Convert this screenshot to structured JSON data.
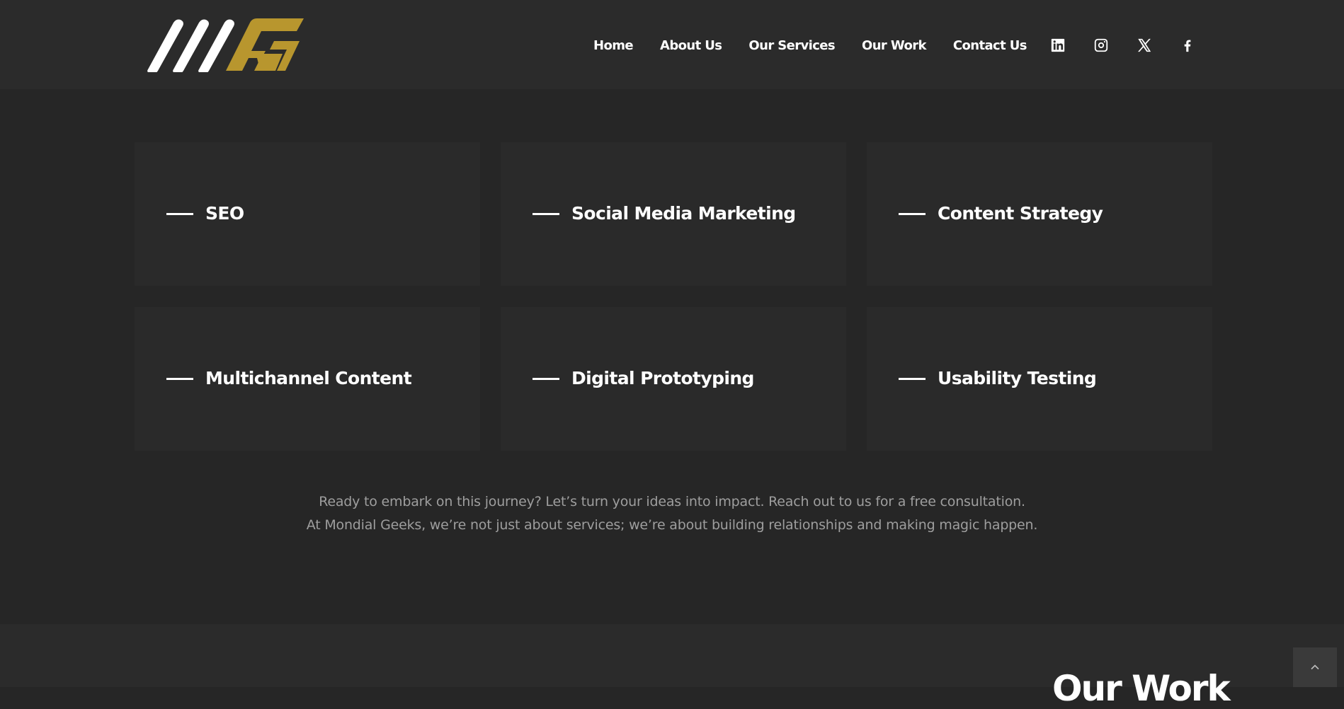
{
  "colors": {
    "page_background": "#262626",
    "header_background": "#2b2b2b",
    "card_background": "#2a2a2a",
    "brand_gold": "#b8962e",
    "text_white": "#ffffff",
    "text_muted": "#9e9e9e"
  },
  "header": {
    "logo": {
      "name": "mondial-geeks-logo"
    },
    "nav": [
      {
        "label": "Home"
      },
      {
        "label": "About Us"
      },
      {
        "label": "Our Services"
      },
      {
        "label": "Our Work"
      },
      {
        "label": "Contact Us"
      }
    ],
    "social": [
      {
        "icon": "linkedin-icon"
      },
      {
        "icon": "instagram-icon"
      },
      {
        "icon": "x-icon"
      },
      {
        "icon": "facebook-icon"
      }
    ]
  },
  "services": [
    {
      "title": "SEO"
    },
    {
      "title": "Social Media Marketing"
    },
    {
      "title": "Content Strategy"
    },
    {
      "title": "Multichannel Content"
    },
    {
      "title": "Digital Prototyping"
    },
    {
      "title": "Usability Testing"
    }
  ],
  "tagline": {
    "line1": "Ready to embark on this journey? Let’s turn your ideas into impact. Reach out to us for a free consultation.",
    "line2": "At Mondial Geeks, we’re not just about services; we’re about building relationships and making magic happen."
  },
  "next_section": {
    "heading": "Our Work"
  },
  "scroll_top": {
    "icon": "chevron-up-icon"
  }
}
